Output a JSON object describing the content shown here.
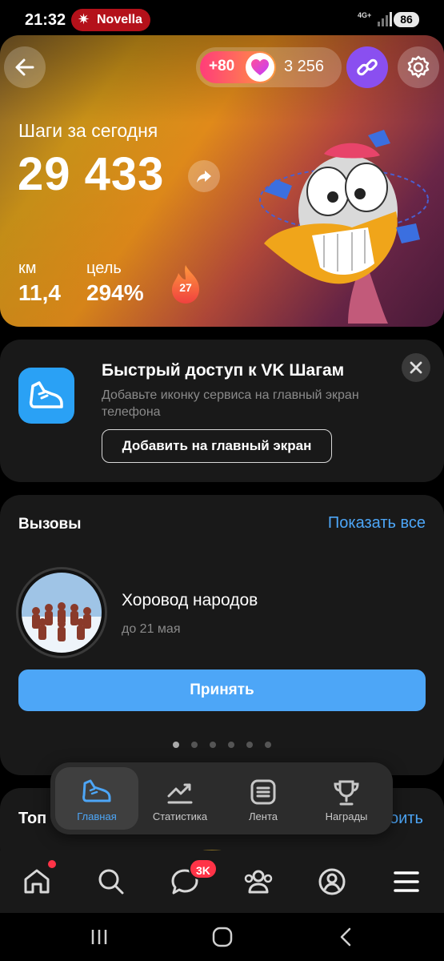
{
  "status_bar": {
    "time": "21:32",
    "notification": "Novella",
    "network": "4G+",
    "battery": "86"
  },
  "hero": {
    "coins_bonus": "+80",
    "coins_total": "3 256",
    "steps_label": "Шаги за сегодня",
    "steps_value": "29 433",
    "km_label": "км",
    "km_value": "11,4",
    "goal_label": "цель",
    "goal_value": "294%",
    "streak_days": "27"
  },
  "quick_access": {
    "title": "Быстрый доступ к VK Шагам",
    "description": "Добавьте иконку сервиса на главный экран телефона",
    "button_label": "Добавить на главный экран"
  },
  "challenges": {
    "title": "Вызовы",
    "show_all": "Показать все",
    "item": {
      "name": "Хоровод народов",
      "deadline": "до 21 мая"
    },
    "accept_label": "Принять",
    "pager": {
      "count": 6,
      "active_index": 0
    }
  },
  "top_section": {
    "title": "Топ",
    "action": "оить"
  },
  "tabs": [
    {
      "label": "Главная",
      "icon": "sneaker-icon",
      "active": true
    },
    {
      "label": "Статистика",
      "icon": "chart-icon",
      "active": false
    },
    {
      "label": "Лента",
      "icon": "feed-icon",
      "active": false
    },
    {
      "label": "Награды",
      "icon": "trophy-icon",
      "active": false
    }
  ],
  "bottom_nav": {
    "items": [
      "home-icon",
      "search-icon",
      "messages-icon",
      "friends-icon",
      "profile-icon",
      "menu-icon"
    ],
    "messages_badge": "3K"
  },
  "colors": {
    "accent": "#4da6f7",
    "badge": "#ff3347",
    "link_button": "#8a4ff0",
    "card_bg": "#191919"
  }
}
